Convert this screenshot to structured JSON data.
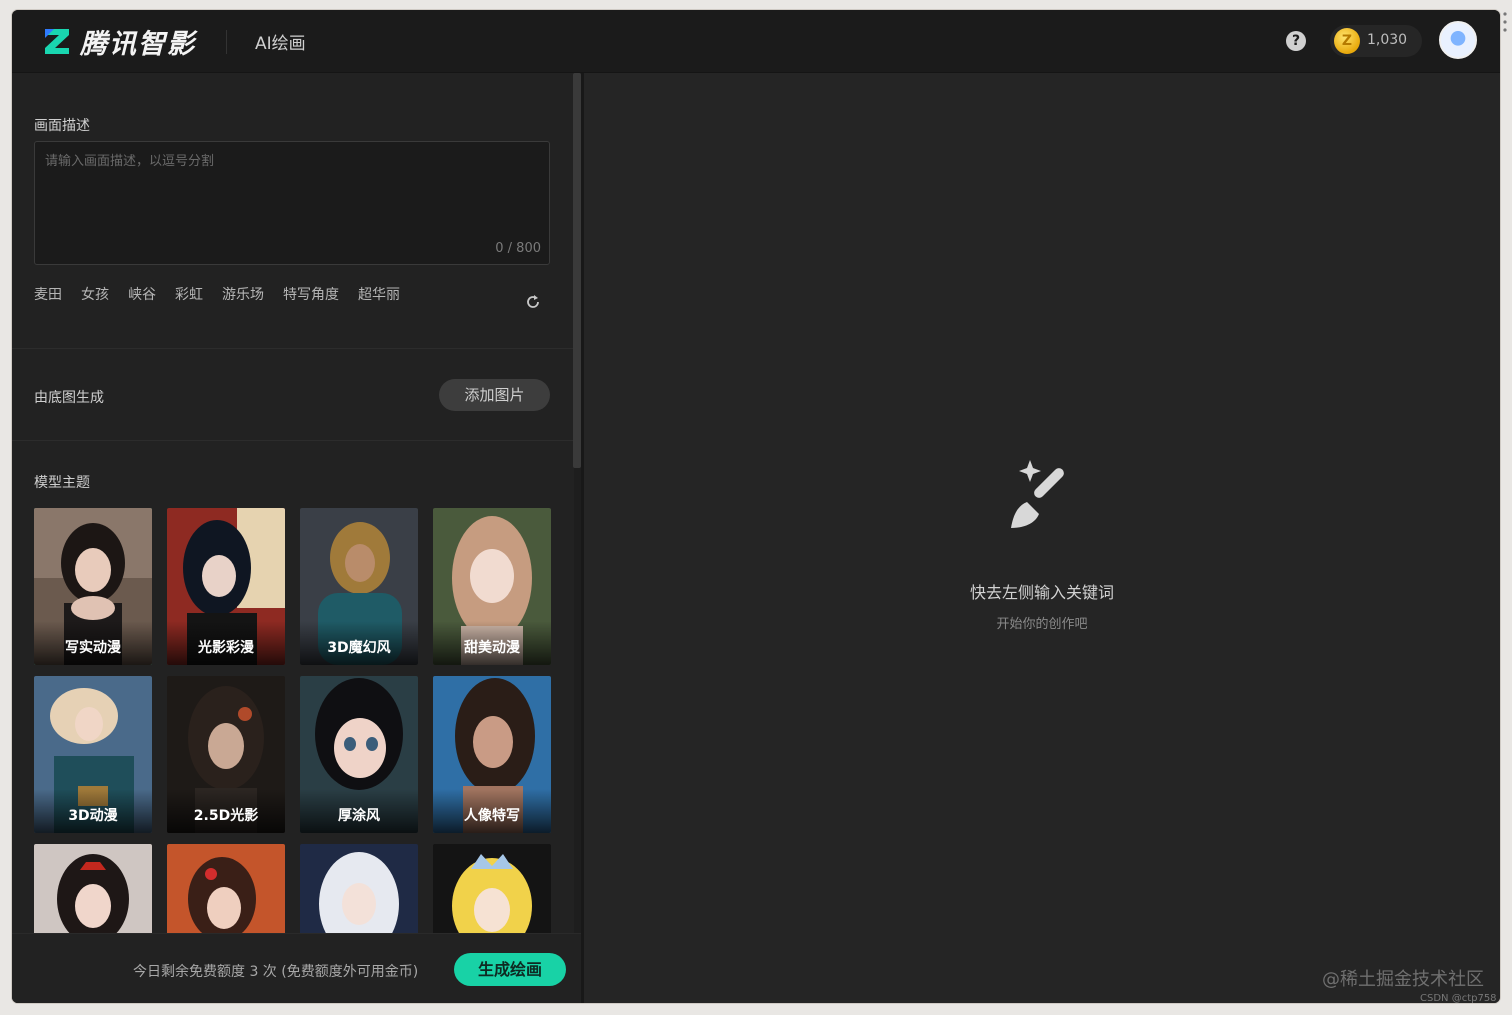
{
  "header": {
    "brand": "腾讯智影",
    "nav_title": "AI绘画",
    "help_icon": "question-circle-icon",
    "coin_icon": "coin-icon",
    "coin_glyph": "Z",
    "coins": "1,030"
  },
  "prompt": {
    "section_label": "画面描述",
    "placeholder": "请输入画面描述，以逗号分割",
    "value": "",
    "char_count": "0 / 800",
    "keywords": [
      "麦田",
      "女孩",
      "峡谷",
      "彩虹",
      "游乐场",
      "特写角度",
      "超华丽"
    ],
    "refresh_icon": "refresh-icon"
  },
  "base_image": {
    "section_label": "由底图生成",
    "add_button": "添加图片"
  },
  "model_theme": {
    "section_label": "模型主题",
    "items": [
      {
        "label": "写实动漫",
        "selected": true
      },
      {
        "label": "光影彩漫",
        "selected": false
      },
      {
        "label": "3D魔幻风",
        "selected": false
      },
      {
        "label": "甜美动漫",
        "selected": false
      },
      {
        "label": "3D动漫",
        "selected": false
      },
      {
        "label": "2.5D光影",
        "selected": false
      },
      {
        "label": "厚涂风",
        "selected": false
      },
      {
        "label": "人像特写",
        "selected": false
      },
      {
        "label": "",
        "selected": false
      },
      {
        "label": "",
        "selected": false
      },
      {
        "label": "",
        "selected": false
      },
      {
        "label": "",
        "selected": false
      }
    ]
  },
  "footer": {
    "quota_text": "今日剩余免费额度 3 次 (免费额度外可用金币)",
    "generate_button": "生成绘画"
  },
  "empty_state": {
    "icon": "paintbrush-sparkle-icon",
    "title": "快去左侧输入关键词",
    "subtitle": "开始你的创作吧"
  },
  "watermark": {
    "main": "@稀土掘金技术社区",
    "small": "CSDN @ctp758"
  },
  "colors": {
    "accent": "#18d2a6",
    "background": "#1e1e1e",
    "panel": "#222222"
  }
}
